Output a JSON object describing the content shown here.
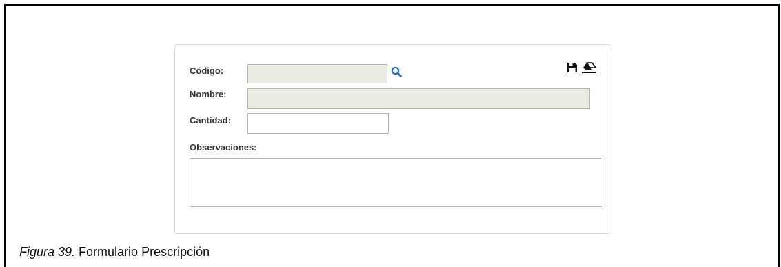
{
  "form": {
    "codigo_label": "Código:",
    "codigo_value": "",
    "nombre_label": "Nombre:",
    "nombre_value": "",
    "cantidad_label": "Cantidad:",
    "cantidad_value": "",
    "observaciones_label": "Observaciones:",
    "observaciones_value": ""
  },
  "icons": {
    "search": "search-icon",
    "save": "save-icon",
    "clear": "eraser-icon"
  },
  "caption": {
    "figure_label": "Figura 39.",
    "text": " Formulario Prescripción"
  },
  "colors": {
    "search_icon": "#2a6db5",
    "readonly_bg": "#ebebe4"
  }
}
